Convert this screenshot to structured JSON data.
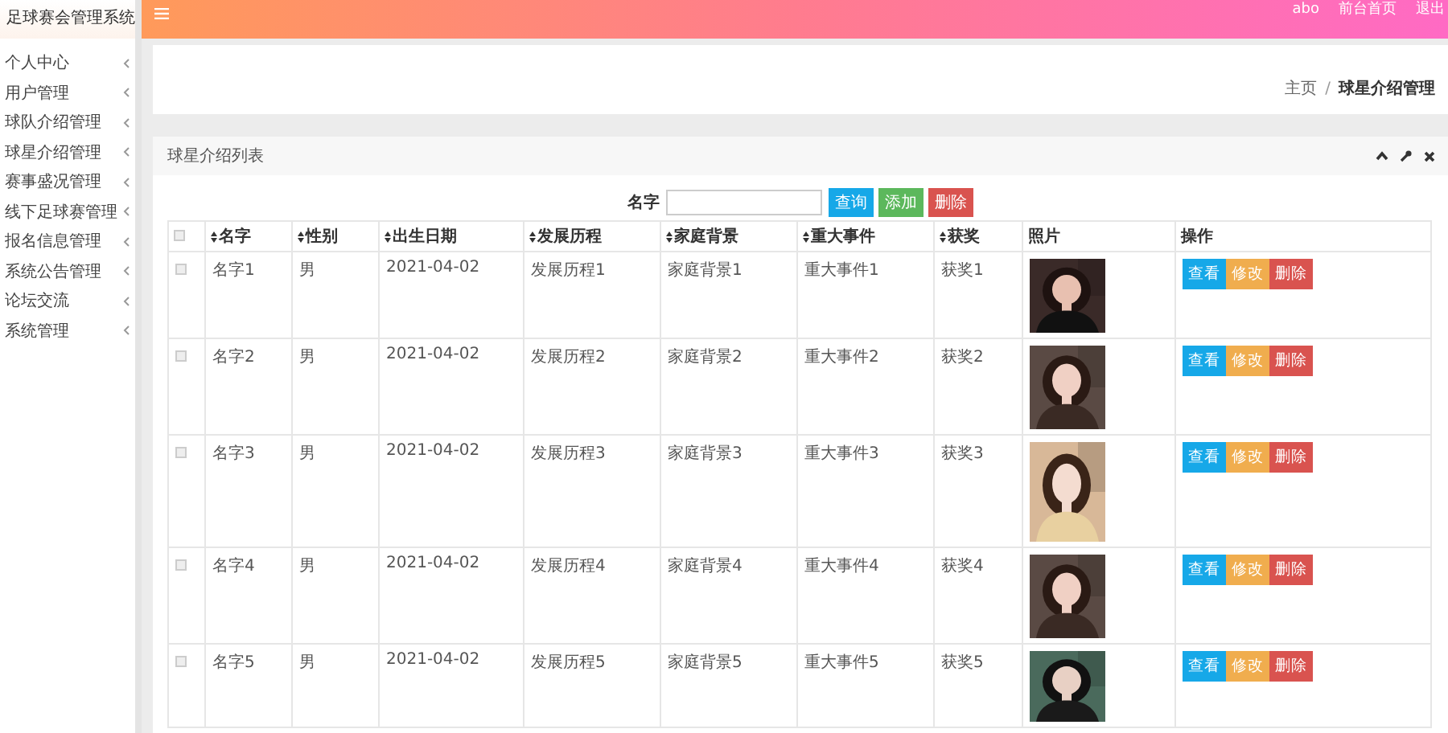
{
  "app_title": "足球赛会管理系统",
  "topbar": {
    "user": "abo",
    "links": [
      "前台首页",
      "退出"
    ]
  },
  "sidebar": {
    "items": [
      {
        "label": "个人中心"
      },
      {
        "label": "用户管理"
      },
      {
        "label": "球队介绍管理"
      },
      {
        "label": "球星介绍管理"
      },
      {
        "label": "赛事盛况管理"
      },
      {
        "label": "线下足球赛管理"
      },
      {
        "label": "报名信息管理"
      },
      {
        "label": "系统公告管理"
      },
      {
        "label": "论坛交流"
      },
      {
        "label": "系统管理"
      }
    ]
  },
  "breadcrumb": {
    "items": [
      "主页",
      "球星介绍管理"
    ],
    "separator": "/"
  },
  "panel": {
    "title": "球星介绍列表",
    "search": {
      "label": "名字",
      "buttons": [
        {
          "label": "查询",
          "kind": "info"
        },
        {
          "label": "添加",
          "kind": "success"
        },
        {
          "label": "删除",
          "kind": "danger"
        }
      ]
    },
    "table": {
      "select_all_checked": false,
      "columns": [
        {
          "label": "名字",
          "sortable": true
        },
        {
          "label": "性别",
          "sortable": true
        },
        {
          "label": "出生日期",
          "sortable": true
        },
        {
          "label": "发展历程",
          "sortable": true
        },
        {
          "label": "家庭背景",
          "sortable": true
        },
        {
          "label": "重大事件",
          "sortable": true
        },
        {
          "label": "获奖",
          "sortable": true
        },
        {
          "label": "照片",
          "sortable": false
        },
        {
          "label": "操作",
          "sortable": false
        }
      ],
      "rows": [
        {
          "checked": false,
          "cells": [
            "名字1",
            "男",
            "2021-04-02",
            "发展历程1",
            "家庭背景1",
            "重大事件1",
            "获奖1"
          ],
          "actions": [
            "查看",
            "修改",
            "删除"
          ]
        },
        {
          "checked": false,
          "cells": [
            "名字2",
            "男",
            "2021-04-02",
            "发展历程2",
            "家庭背景2",
            "重大事件2",
            "获奖2"
          ],
          "actions": [
            "查看",
            "修改",
            "删除"
          ]
        },
        {
          "checked": false,
          "cells": [
            "名字3",
            "男",
            "2021-04-02",
            "发展历程3",
            "家庭背景3",
            "重大事件3",
            "获奖3"
          ],
          "actions": [
            "查看",
            "修改",
            "删除"
          ]
        },
        {
          "checked": false,
          "cells": [
            "名字4",
            "男",
            "2021-04-02",
            "发展历程4",
            "家庭背景4",
            "重大事件4",
            "获奖4"
          ],
          "actions": [
            "查看",
            "修改",
            "删除"
          ]
        },
        {
          "checked": false,
          "cells": [
            "名字5",
            "男",
            "2021-04-02",
            "发展历程5",
            "家庭背景5",
            "重大事件5",
            "获奖5"
          ],
          "actions": [
            "查看",
            "修改",
            "删除"
          ]
        }
      ]
    }
  }
}
